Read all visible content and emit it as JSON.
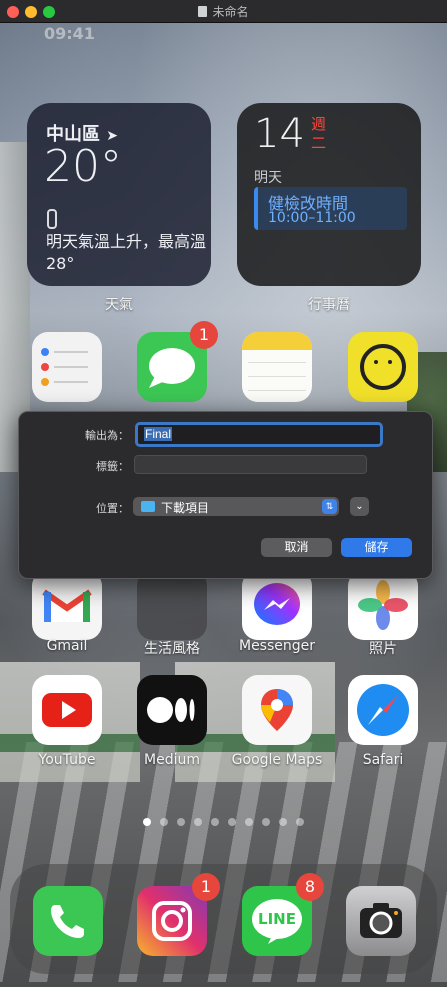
{
  "window": {
    "title": "未命名"
  },
  "status_bar": {
    "time": "09:41"
  },
  "widgets": {
    "weather": {
      "location": "中山區",
      "temperature": "20°",
      "forecast": "明天氣溫上升，最高溫 28°",
      "label": "天氣"
    },
    "calendar": {
      "date": "14",
      "weekday": "週二",
      "tomorrow": "明天",
      "event_title": "健檢改時間",
      "event_time": "10:00–11:00",
      "label": "行事曆"
    }
  },
  "apps": {
    "row1": [
      {
        "name": "提醒事項",
        "label": ""
      },
      {
        "name": "訊息",
        "label": "",
        "badge": "1"
      },
      {
        "name": "備忘錄",
        "label": ""
      },
      {
        "name": "Foodie",
        "label": ""
      }
    ],
    "row2": [
      {
        "label": "Gmail"
      },
      {
        "label": "生活風格"
      },
      {
        "label": "Messenger"
      },
      {
        "label": "照片"
      }
    ],
    "row3": [
      {
        "label": "YouTube"
      },
      {
        "label": "Medium"
      },
      {
        "label": "Google Maps"
      },
      {
        "label": "Safari"
      }
    ]
  },
  "dock": [
    {
      "name": "phone"
    },
    {
      "name": "instagram",
      "badge": "1"
    },
    {
      "name": "line",
      "badge": "8",
      "text": "LINE"
    },
    {
      "name": "camera"
    }
  ],
  "save_dialog": {
    "export_as_label": "輸出為：",
    "filename": "Final",
    "tags_label": "標籤：",
    "location_label": "位置：",
    "location_value": "下載項目",
    "cancel_label": "取消",
    "save_label": "儲存"
  },
  "colors": {
    "accent": "#2f79e8",
    "badge": "#e6463b",
    "calendar_red": "#ff453a"
  }
}
